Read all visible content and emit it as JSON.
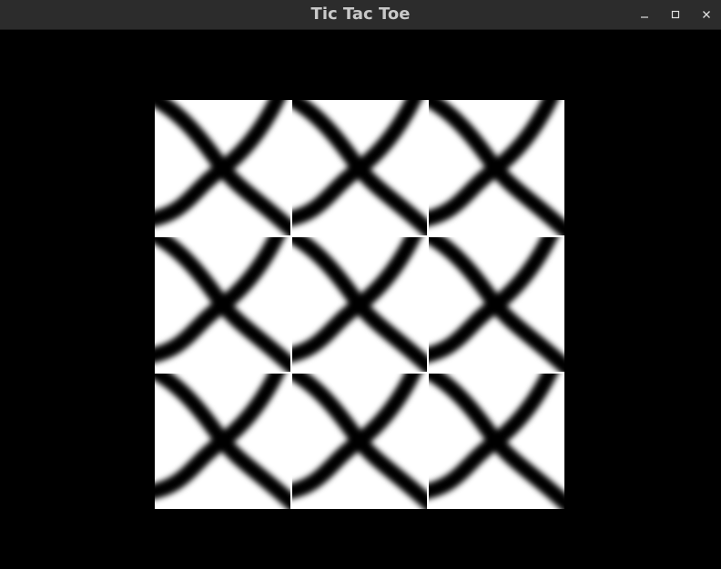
{
  "window": {
    "title": "Tic Tac Toe",
    "controls": {
      "minimize": "–",
      "maximize": "□",
      "close": "✕"
    }
  },
  "board": {
    "rows": 3,
    "cols": 3,
    "cells": [
      "X",
      "X",
      "X",
      "X",
      "X",
      "X",
      "X",
      "X",
      "X"
    ],
    "colors": {
      "background": "#000000",
      "cell": "#ffffff",
      "mark": "#000000",
      "grid_line": "#ffffff"
    }
  }
}
